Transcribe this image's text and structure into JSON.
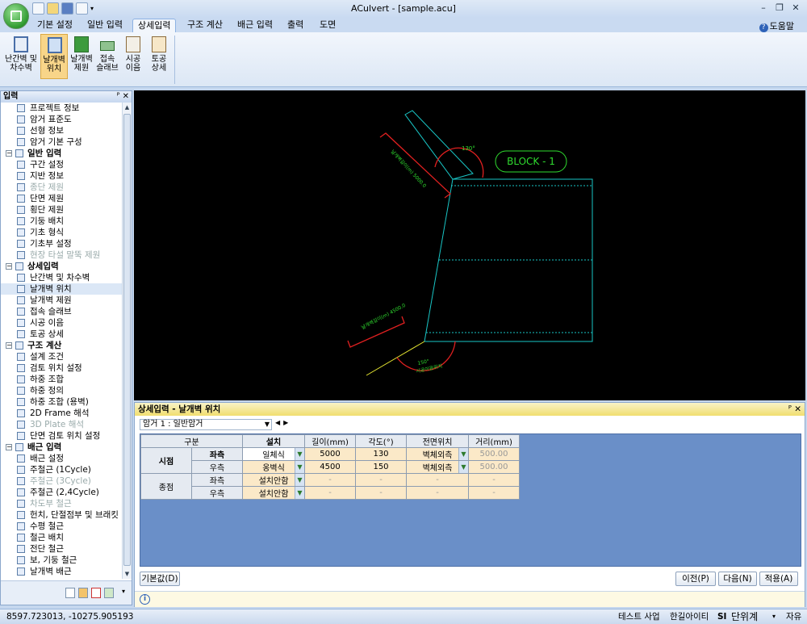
{
  "window": {
    "title": "ACulvert - [sample.acu]"
  },
  "ribbon": {
    "tabs": [
      "기본 설정",
      "일반 입력",
      "상세입력",
      "구조 계산",
      "배근 입력",
      "출력",
      "도면"
    ],
    "active_tab": "상세입력",
    "help_label": "도움말",
    "buttons": [
      {
        "label1": "난간벽 및",
        "label2": "차수벽"
      },
      {
        "label1": "날개벽",
        "label2": "위치"
      },
      {
        "label1": "날개벽",
        "label2": "제원"
      },
      {
        "label1": "접속",
        "label2": "슬래브"
      },
      {
        "label1": "시공",
        "label2": "이음"
      },
      {
        "label1": "토공",
        "label2": "상세"
      }
    ]
  },
  "input_panel": {
    "title": "입력",
    "tree": [
      {
        "label": "프로젝트 정보",
        "type": "item",
        "icon": "project-info-icon"
      },
      {
        "label": "암거 표준도",
        "type": "item",
        "icon": "standard-drawing-icon"
      },
      {
        "label": "선형 정보",
        "type": "item",
        "icon": "alignment-icon"
      },
      {
        "label": "암거 기본 구성",
        "type": "item",
        "icon": "culvert-config-icon"
      },
      {
        "label": "일반 입력",
        "type": "group"
      },
      {
        "label": "구간 설정",
        "type": "item",
        "icon": "section-icon"
      },
      {
        "label": "지반 정보",
        "type": "item",
        "icon": "ground-icon"
      },
      {
        "label": "종단 제원",
        "type": "item",
        "icon": "longitudinal-icon",
        "disabled": true
      },
      {
        "label": "단면 제원",
        "type": "item",
        "icon": "cross-section-icon"
      },
      {
        "label": "횡단 제원",
        "type": "item",
        "icon": "transverse-icon"
      },
      {
        "label": "기둥 배치",
        "type": "item",
        "icon": "column-icon"
      },
      {
        "label": "기초 형식",
        "type": "item",
        "icon": "foundation-icon"
      },
      {
        "label": "기초부 설정",
        "type": "item",
        "icon": "foundation-setting-icon"
      },
      {
        "label": "현장 타설 말뚝 제원",
        "type": "item",
        "icon": "pile-icon",
        "disabled": true
      },
      {
        "label": "상세입력",
        "type": "group"
      },
      {
        "label": "난간벽 및 차수벽",
        "type": "item",
        "icon": "parapet-icon"
      },
      {
        "label": "날개벽 위치",
        "type": "item",
        "icon": "wingwall-position-icon",
        "selected": true
      },
      {
        "label": "날개벽 제원",
        "type": "item",
        "icon": "wingwall-dimension-icon"
      },
      {
        "label": "접속 슬래브",
        "type": "item",
        "icon": "approach-slab-icon"
      },
      {
        "label": "시공 이음",
        "type": "item",
        "icon": "construction-joint-icon"
      },
      {
        "label": "토공 상세",
        "type": "item",
        "icon": "earthwork-icon"
      },
      {
        "label": "구조 계산",
        "type": "group"
      },
      {
        "label": "설계 조건",
        "type": "item",
        "icon": "design-condition-icon"
      },
      {
        "label": "검토 위치 설정",
        "type": "item",
        "icon": "check-position-icon"
      },
      {
        "label": "하중 조합",
        "type": "item",
        "icon": "load-combination-icon"
      },
      {
        "label": "하중 정의",
        "type": "item",
        "icon": "load-definition-icon"
      },
      {
        "label": "하중 조합 (용벽)",
        "type": "item",
        "icon": "load-combination-wall-icon"
      },
      {
        "label": "2D Frame 해석",
        "type": "item",
        "icon": "frame-2d-icon"
      },
      {
        "label": "3D Plate 해석",
        "type": "item",
        "icon": "plate-3d-icon",
        "disabled": true
      },
      {
        "label": "단면 검토 위치 설정",
        "type": "item",
        "icon": "section-check-icon"
      },
      {
        "label": "배근 입력",
        "type": "group"
      },
      {
        "label": "배근 설정",
        "type": "item",
        "icon": "rebar-setting-icon"
      },
      {
        "label": "주철근 (1Cycle)",
        "type": "item",
        "icon": "main-rebar-icon"
      },
      {
        "label": "주철근 (3Cycle)",
        "type": "item",
        "icon": "main-rebar-icon",
        "disabled": true
      },
      {
        "label": "주철근 (2,4Cycle)",
        "type": "item",
        "icon": "main-rebar-icon"
      },
      {
        "label": "차도부 철근",
        "type": "item",
        "icon": "road-rebar-icon",
        "disabled": true
      },
      {
        "label": "헌치, 단절점부 및 브래킷",
        "type": "item",
        "icon": "haunch-icon"
      },
      {
        "label": "수평 철근",
        "type": "item",
        "icon": "horizontal-rebar-icon"
      },
      {
        "label": "철근 배치",
        "type": "item",
        "icon": "rebar-layout-icon"
      },
      {
        "label": "전단 철근",
        "type": "item",
        "icon": "shear-rebar-icon"
      },
      {
        "label": "보, 기둥 철근",
        "type": "item",
        "icon": "beam-column-rebar-icon"
      },
      {
        "label": "날개벽 배근",
        "type": "item",
        "icon": "wingwall-rebar-icon"
      }
    ]
  },
  "drawing": {
    "block_label": "BLOCK - 1",
    "top_angle": "130°",
    "bottom_angle": "150°",
    "top_dim_text": "날개벽길이(m) 5000.0",
    "bottom_dim_text": "날개벽길이(m) 4500.0",
    "bottom_note": "시공이음위치"
  },
  "detail_panel": {
    "title": "상세입력 - 날개벽 위치",
    "culvert_select": "암거 1 : 일반암거",
    "columns": [
      "구분",
      "설치",
      "길이(mm)",
      "각도(°)",
      "전면위치",
      "거리(mm)"
    ],
    "groups": [
      {
        "name": "시점",
        "rows": [
          {
            "side": "좌측",
            "install": "일체식",
            "length": "5000",
            "angle": "130",
            "front": "벽체외측",
            "distance": "500.00"
          },
          {
            "side": "우측",
            "install": "옹벽식",
            "length": "4500",
            "angle": "150",
            "front": "벽체외측",
            "distance": "500.00"
          }
        ]
      },
      {
        "name": "종점",
        "rows": [
          {
            "side": "좌측",
            "install": "설치안함",
            "length": "-",
            "angle": "-",
            "front": "-",
            "distance": "-"
          },
          {
            "side": "우측",
            "install": "설치안함",
            "length": "-",
            "angle": "-",
            "front": "-",
            "distance": "-"
          }
        ]
      }
    ],
    "buttons": {
      "default": "기본값(D)",
      "prev": "이전(P)",
      "next": "다음(N)",
      "apply": "적용(A)"
    }
  },
  "status": {
    "coords": "8597.723013,  -10275.905193",
    "project": "테스트 사업",
    "company": "한길아이티",
    "unit_prefix": "SI",
    "unit_label": "단위계",
    "mode": "자유"
  }
}
